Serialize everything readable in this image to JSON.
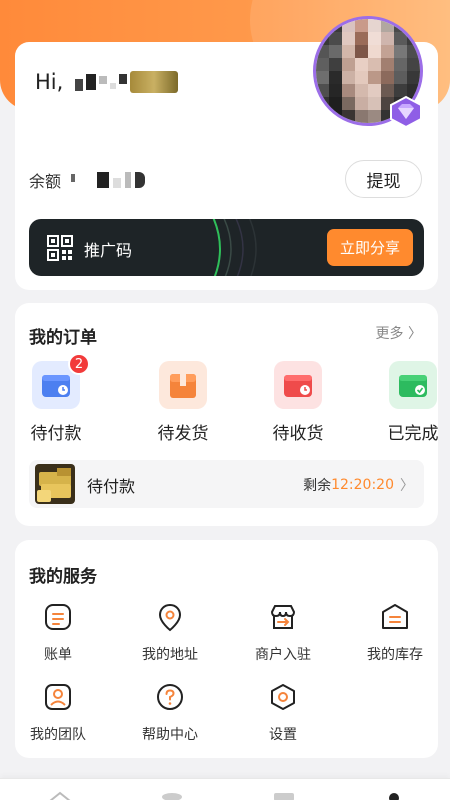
{
  "profile": {
    "greeting": "Hi,",
    "balance_label": "余额",
    "withdraw_label": "提现",
    "promo_label": "推广码",
    "share_label": "立即分享"
  },
  "orders": {
    "title": "我的订单",
    "more_label": "更多 〉",
    "items": [
      {
        "label": "待付款",
        "icon": "wallet-icon",
        "badge": "2"
      },
      {
        "label": "待发货",
        "icon": "package-icon"
      },
      {
        "label": "待收货",
        "icon": "delivery-wallet-icon"
      },
      {
        "label": "已完成",
        "icon": "completed-wallet-icon"
      }
    ],
    "pending": {
      "label": "待付款",
      "remaining_label": "剩余",
      "timer": "12:20:20",
      "chevron": "〉"
    }
  },
  "services": {
    "title": "我的服务",
    "items": [
      {
        "label": "账单",
        "icon": "bill-icon"
      },
      {
        "label": "我的地址",
        "icon": "location-icon"
      },
      {
        "label": "商户入驻",
        "icon": "merchant-icon"
      },
      {
        "label": "我的库存",
        "icon": "inventory-icon"
      },
      {
        "label": "我的团队",
        "icon": "team-icon"
      },
      {
        "label": "帮助中心",
        "icon": "help-icon"
      },
      {
        "label": "设置",
        "icon": "settings-icon"
      }
    ]
  },
  "colors": {
    "accent": "#ff8a2e",
    "header_gradient_start": "#ff8a3a",
    "promo_bg": "#1e2427",
    "badge_red": "#f23b3b",
    "vip_purple": "#9c6ee8"
  }
}
